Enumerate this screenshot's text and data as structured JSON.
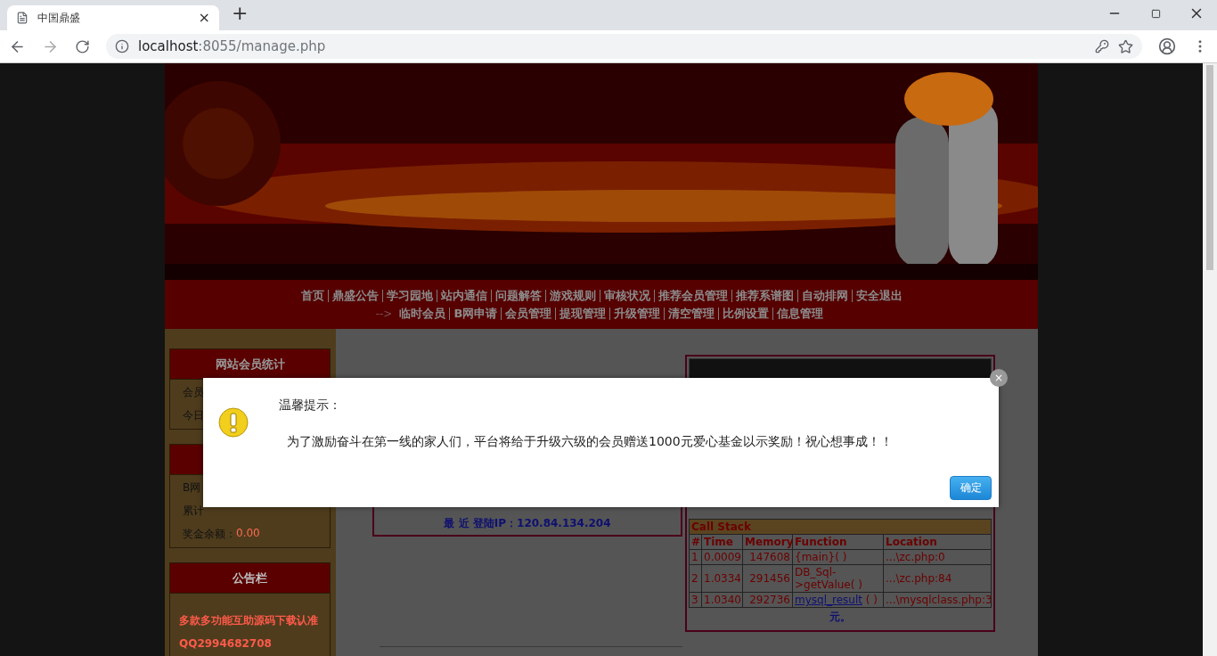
{
  "browser": {
    "tab_title": "中国鼎盛",
    "tab_close": "×",
    "new_tab": "+",
    "url_host": "localhost",
    "url_path": ":8055/manage.php"
  },
  "nav": {
    "rows": [
      {
        "prefix": "",
        "items": [
          "首页",
          "鼎盛公告",
          "学习园地",
          "站内通信",
          "问题解答",
          "游戏规则",
          "审核状况",
          "推荐会员管理",
          "推荐系谱图",
          "自动排网",
          "安全退出"
        ]
      },
      {
        "prefix": "-->",
        "items": [
          "临时会员",
          "B网申请",
          "会员管理",
          "提现管理",
          "升级管理",
          "清空管理",
          "比例设置",
          "信息管理"
        ]
      }
    ]
  },
  "sidebar": [
    {
      "title": "网站会员统计",
      "lines": [
        {
          "label": "会员"
        },
        {
          "label": "今日"
        }
      ]
    },
    {
      "lines": [
        {
          "label": "B网"
        },
        {
          "label": "累计"
        },
        {
          "label": "奖金余额：",
          "value": "0.00"
        }
      ]
    },
    {
      "title": "公告栏",
      "notices": [
        "多款多功能互助源码下载认准",
        "QQ2994682708"
      ]
    }
  ],
  "login_info": {
    "ip_line": "最 近 登陆IP：120.84.134.204"
  },
  "upgrade_panel": {
    "call_stack": {
      "title": "Call Stack",
      "columns": [
        "#",
        "Time",
        "Memory",
        "Function",
        "Location"
      ],
      "rows": [
        {
          "n": "1",
          "time": "0.0009",
          "memory": "147608",
          "kind": "text",
          "function": "{main}( )",
          "location": "...\\zc.php:0"
        },
        {
          "n": "2",
          "time": "1.0334",
          "memory": "291456",
          "kind": "text",
          "function": "DB_Sql->getValue( )",
          "location": "...\\zc.php:84"
        },
        {
          "n": "3",
          "time": "1.0340",
          "memory": "292736",
          "kind": "link",
          "function": "mysql_result",
          "function_suffix": " ( )",
          "location": "...\\mysqlclass.php:3"
        }
      ]
    },
    "footer": "元。"
  },
  "dialog": {
    "title": "温馨提示：",
    "message": "为了激励奋斗在第一线的家人们，平台将给于升级六级的会员赠送1000元爱心基金以示奖励！祝心想事成！！",
    "button": "确定",
    "close": "×"
  }
}
